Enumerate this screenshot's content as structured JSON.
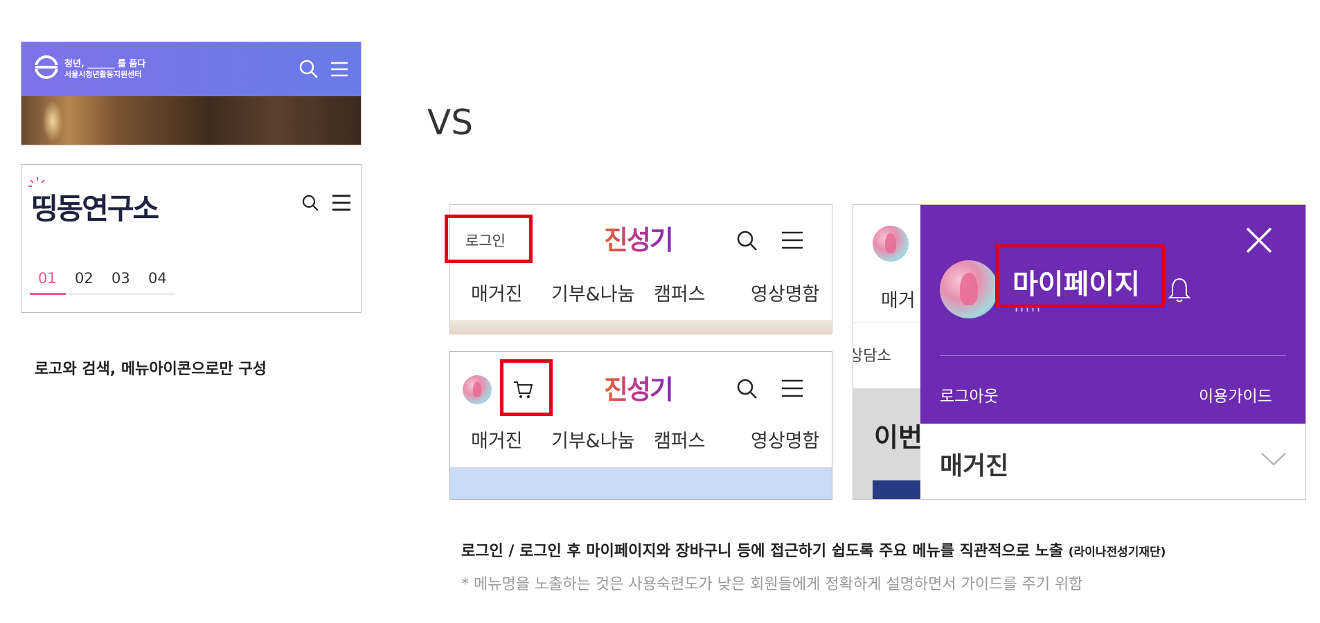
{
  "vs_label": "VS",
  "panel1": {
    "line1": "청년, ______ 를 품다",
    "line2": "서울시청년활동지원센터",
    "bg_colors": [
      "#7d73ea",
      "#5b6ee3"
    ]
  },
  "panel2": {
    "logo_text": "띵동연구소",
    "tabs": [
      "01",
      "02",
      "03",
      "04"
    ],
    "accent": "#e85a8c"
  },
  "caption_left": "로고와 검색, 메뉴아이콘으로만 구성",
  "panel3": {
    "login_label": "로그인",
    "logo_text": "진성기",
    "nav": [
      "매거진",
      "기부&나눔",
      "캠퍼스",
      "영상명함"
    ]
  },
  "panel4": {
    "logo_text": "진성기",
    "nav": [
      "매거진",
      "기부&나눔",
      "캠퍼스",
      "영상명함"
    ]
  },
  "panel5": {
    "behind_nav": "매거",
    "behind_side": "상담소",
    "behind_headline": "이번",
    "drawer": {
      "mypage_label": "마이페이지",
      "dots": "ııııı",
      "logout_label": "로그아웃",
      "guide_label": "이용가이드",
      "menu_item": "매거진",
      "bg_color": "#6d2bb3"
    }
  },
  "caption_main": "로그인 / 로그인 후 마이페이지와 장바구니 등에 접근하기 쉽도록 주요 메뉴를 직관적으로 노출",
  "caption_main_small": "(라이나전성기재단)",
  "caption_note": "* 메뉴명을 노출하는 것은 사용숙련도가 낮은 회원들에게 정확하게 설명하면서 가이드를 주기 위함",
  "colors": {
    "highlight": "#e3001b",
    "drawer": "#6d2bb3"
  }
}
